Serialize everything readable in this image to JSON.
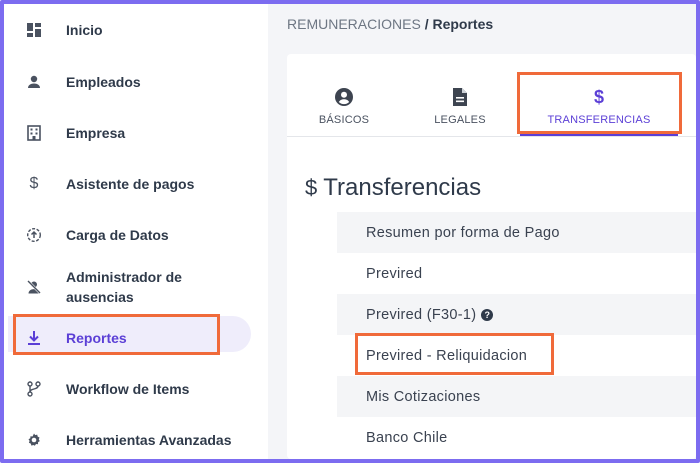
{
  "sidebar": {
    "items": [
      {
        "label": "Inicio",
        "icon": "dashboard-icon"
      },
      {
        "label": "Empleados",
        "icon": "person-icon"
      },
      {
        "label": "Empresa",
        "icon": "building-icon"
      },
      {
        "label": "Asistente de pagos",
        "icon": "dollar-icon"
      },
      {
        "label": "Carga de Datos",
        "icon": "upload-icon"
      },
      {
        "label": "Administrador de ausencias",
        "icon": "person-off-icon"
      },
      {
        "label": "Reportes",
        "icon": "download-icon"
      },
      {
        "label": "Workflow de Items",
        "icon": "branch-icon"
      },
      {
        "label": "Herramientas Avanzadas",
        "icon": "gear-icon"
      }
    ],
    "active": "Reportes"
  },
  "breadcrumb": {
    "parent": "REMUNERACIONES",
    "separator": "/",
    "current": "Reportes"
  },
  "tabs": [
    {
      "label": "BÁSICOS",
      "icon": "account-circle-icon"
    },
    {
      "label": "LEGALES",
      "icon": "document-icon"
    },
    {
      "label": "TRANSFERENCIAS",
      "icon": "dollar-icon"
    }
  ],
  "active_tab": "TRANSFERENCIAS",
  "section": {
    "icon_glyph": "$",
    "title": "Transferencias"
  },
  "reports": [
    {
      "label": "Resumen por forma de Pago"
    },
    {
      "label": "Previred"
    },
    {
      "label": "Previred (F30-1)",
      "help_glyph": "?"
    },
    {
      "label": "Previred - Reliquidacion"
    },
    {
      "label": "Mis Cotizaciones"
    },
    {
      "label": "Banco Chile"
    }
  ],
  "colors": {
    "accent": "#5b3fd6",
    "highlight": "#f06a3a",
    "frame": "#7c6cf0"
  }
}
